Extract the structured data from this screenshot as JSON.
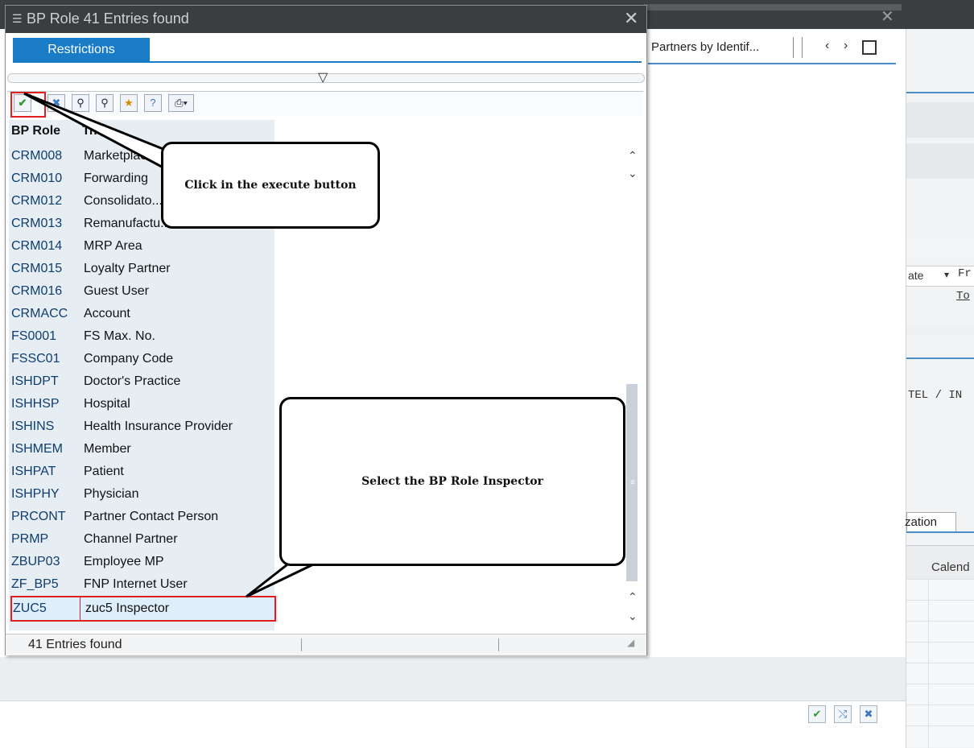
{
  "dialog": {
    "title": "BP Role   41 Entries found",
    "tab_label": "Restrictions",
    "columns": {
      "code": "BP Role",
      "text": "Tr..."
    },
    "rows": [
      {
        "code": "CRM008",
        "name": "Marketplac..."
      },
      {
        "code": "CRM010",
        "name": "Forwarding"
      },
      {
        "code": "CRM012",
        "name": "Consolidato..."
      },
      {
        "code": "CRM013",
        "name": "Remanufactu..."
      },
      {
        "code": "CRM014",
        "name": "MRP Area"
      },
      {
        "code": "CRM015",
        "name": "Loyalty Partner"
      },
      {
        "code": "CRM016",
        "name": "Guest User"
      },
      {
        "code": "CRMACC",
        "name": "Account"
      },
      {
        "code": "FS0001",
        "name": "FS Max. No."
      },
      {
        "code": "FSSC01",
        "name": "Company Code"
      },
      {
        "code": "ISHDPT",
        "name": "Doctor's Practice"
      },
      {
        "code": "ISHHSP",
        "name": "Hospital"
      },
      {
        "code": "ISHINS",
        "name": "Health Insurance Provider"
      },
      {
        "code": "ISHMEM",
        "name": "Member"
      },
      {
        "code": "ISHPAT",
        "name": "Patient"
      },
      {
        "code": "ISHPHY",
        "name": "Physician"
      },
      {
        "code": "PRCONT",
        "name": "Partner Contact Person"
      },
      {
        "code": "PRMP",
        "name": "Channel Partner"
      },
      {
        "code": "ZBUP03",
        "name": "Employee MP"
      },
      {
        "code": "ZF_BP5",
        "name": "FNP Internet User"
      }
    ],
    "selected_row": {
      "code": "ZUC5",
      "name": "zuc5 Inspector"
    },
    "status": "41 Entries found"
  },
  "callouts": {
    "execute": "Click in the execute button",
    "select": "Select the BP Role Inspector"
  },
  "background": {
    "tab_label": "Partners by Identif...",
    "date_label": "ate",
    "from_label": "Fr",
    "to_label": "To",
    "tel_text": "TEL / IN",
    "tab2_label": "zation",
    "calendar_header": "Calend"
  },
  "icons": {
    "execute": "check-icon",
    "cancel": "cancel-icon",
    "find": "binoculars-icon",
    "find_next": "binoculars-plus-icon",
    "favorites": "star-add-icon",
    "help": "help-icon",
    "print": "printer-icon"
  },
  "colors": {
    "title_bar": "#3b3e41",
    "tab_active": "#1a7bc7",
    "highlight_red": "#e02020",
    "column_bg": "#e6eef3",
    "selected_row_bg": "#dfeefb"
  }
}
